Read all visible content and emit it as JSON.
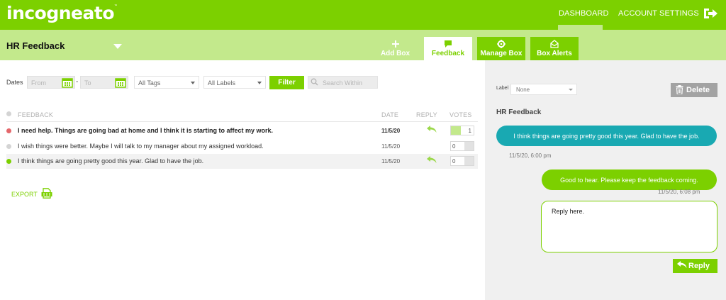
{
  "app": {
    "logo": "incogneato",
    "logo_tm": "™"
  },
  "nav": {
    "dashboard": "DASHBOARD",
    "account_settings": "ACCOUNT SETTINGS"
  },
  "box": {
    "title": "HR Feedback"
  },
  "tabs": {
    "add_box": "Add Box",
    "feedback": "Feedback",
    "manage_box": "Manage Box",
    "box_alerts": "Box Alerts"
  },
  "filters": {
    "dates_label": "Dates",
    "from_placeholder": "From",
    "to_placeholder": "To",
    "dash": "-",
    "tags_value": "All Tags",
    "labels_value": "All Labels",
    "filter_button": "Filter",
    "search_placeholder": "Search Within"
  },
  "table": {
    "headers": {
      "feedback": "FEEDBACK",
      "date": "DATE",
      "reply": "REPLY",
      "votes": "VOTES"
    },
    "rows": [
      {
        "text": "I need help. Things are going bad at home and I think it is starting to affect my work.",
        "date": "11/5/20",
        "votes": "1",
        "status_color": "#e4676b",
        "unread": true,
        "replied": true
      },
      {
        "text": "I wish things were better. Maybe I will talk to my manager about my assigned workload.",
        "date": "11/5/20",
        "votes": "0",
        "status_color": "#d4d4d4",
        "unread": false,
        "replied": false
      },
      {
        "text": "I think things are going pretty good this year. Glad to have the job.",
        "date": "11/5/20",
        "votes": "0",
        "status_color": "#7cd000",
        "unread": false,
        "replied": true
      }
    ]
  },
  "export": {
    "label": "EXPORT",
    "icon": "csv-file-icon"
  },
  "detail": {
    "label_caption": "Label",
    "label_value": "None",
    "delete_button": "Delete",
    "title": "HR Feedback",
    "messages": [
      {
        "text": "I think things are going pretty good this year. Glad to have the job.",
        "timestamp": "11/5/20, 6:00 pm",
        "direction": "in"
      },
      {
        "text": "Good to hear. Please keep the feedback coming.",
        "timestamp": "11/5/20, 6:08 pm",
        "direction": "out"
      }
    ],
    "reply_value": "Reply here.",
    "reply_button": "Reply"
  },
  "colors": {
    "brand_green": "#7cd000",
    "light_green": "#c3e98c",
    "teal": "#19a9b2",
    "red_status": "#e4676b"
  }
}
